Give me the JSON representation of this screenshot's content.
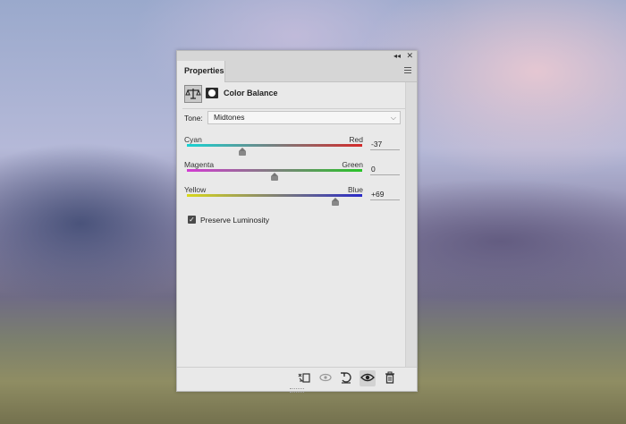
{
  "panel": {
    "tab_label": "Properties",
    "title": "Color Balance",
    "collapse_glyph": "◂◂",
    "close_glyph": "✕",
    "tone": {
      "label": "Tone:",
      "value": "Midtones"
    },
    "sliders": [
      {
        "left": "Cyan",
        "right": "Red",
        "value": "-37",
        "level": -37,
        "min": -100,
        "max": 100,
        "colors": [
          "#19d3d3",
          "#d42a2a"
        ]
      },
      {
        "left": "Magenta",
        "right": "Green",
        "value": "0",
        "level": 0,
        "min": -100,
        "max": 100,
        "colors": [
          "#d33bd3",
          "#28c428"
        ]
      },
      {
        "left": "Yellow",
        "right": "Blue",
        "value": "+69",
        "level": 69,
        "min": -100,
        "max": 100,
        "colors": [
          "#d8d81c",
          "#2a2ac8"
        ]
      }
    ],
    "preserve_luminosity": {
      "label": "Preserve Luminosity",
      "checked": true
    }
  },
  "icons": {
    "adjustment": "color-balance-icon",
    "mask": "mask-icon",
    "bottom": [
      "clip-to-layer-icon",
      "view-previous-state-icon",
      "reset-icon",
      "visibility-eye-icon",
      "delete-trash-icon"
    ]
  }
}
